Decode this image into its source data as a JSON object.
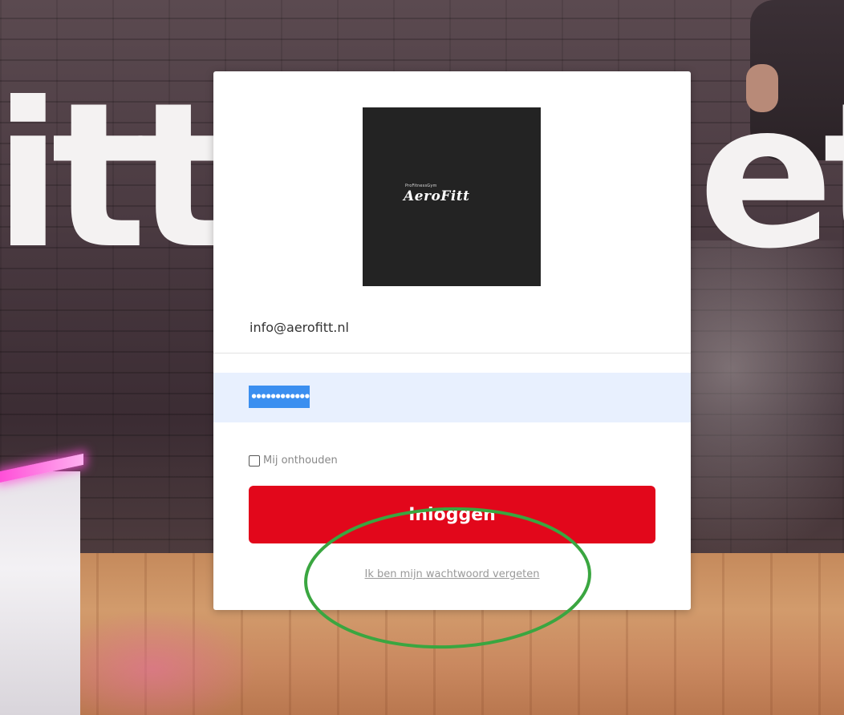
{
  "background": {
    "letters_left": "itt",
    "letters_right": "et"
  },
  "logo": {
    "small_text": "ProFitnessGym",
    "brand": "AeroFitt"
  },
  "form": {
    "email_value": "info@aerofitt.nl",
    "password_mask": "••••••••••••",
    "remember_label": "Mij onthouden",
    "remember_checked": false,
    "login_label": "Inloggen",
    "forgot_label": "Ik ben mijn wachtwoord vergeten"
  },
  "colors": {
    "button": "#e2071b",
    "password_bg": "#e8f0fe",
    "selection": "#3b8ff0",
    "annotation": "#3aa640"
  }
}
